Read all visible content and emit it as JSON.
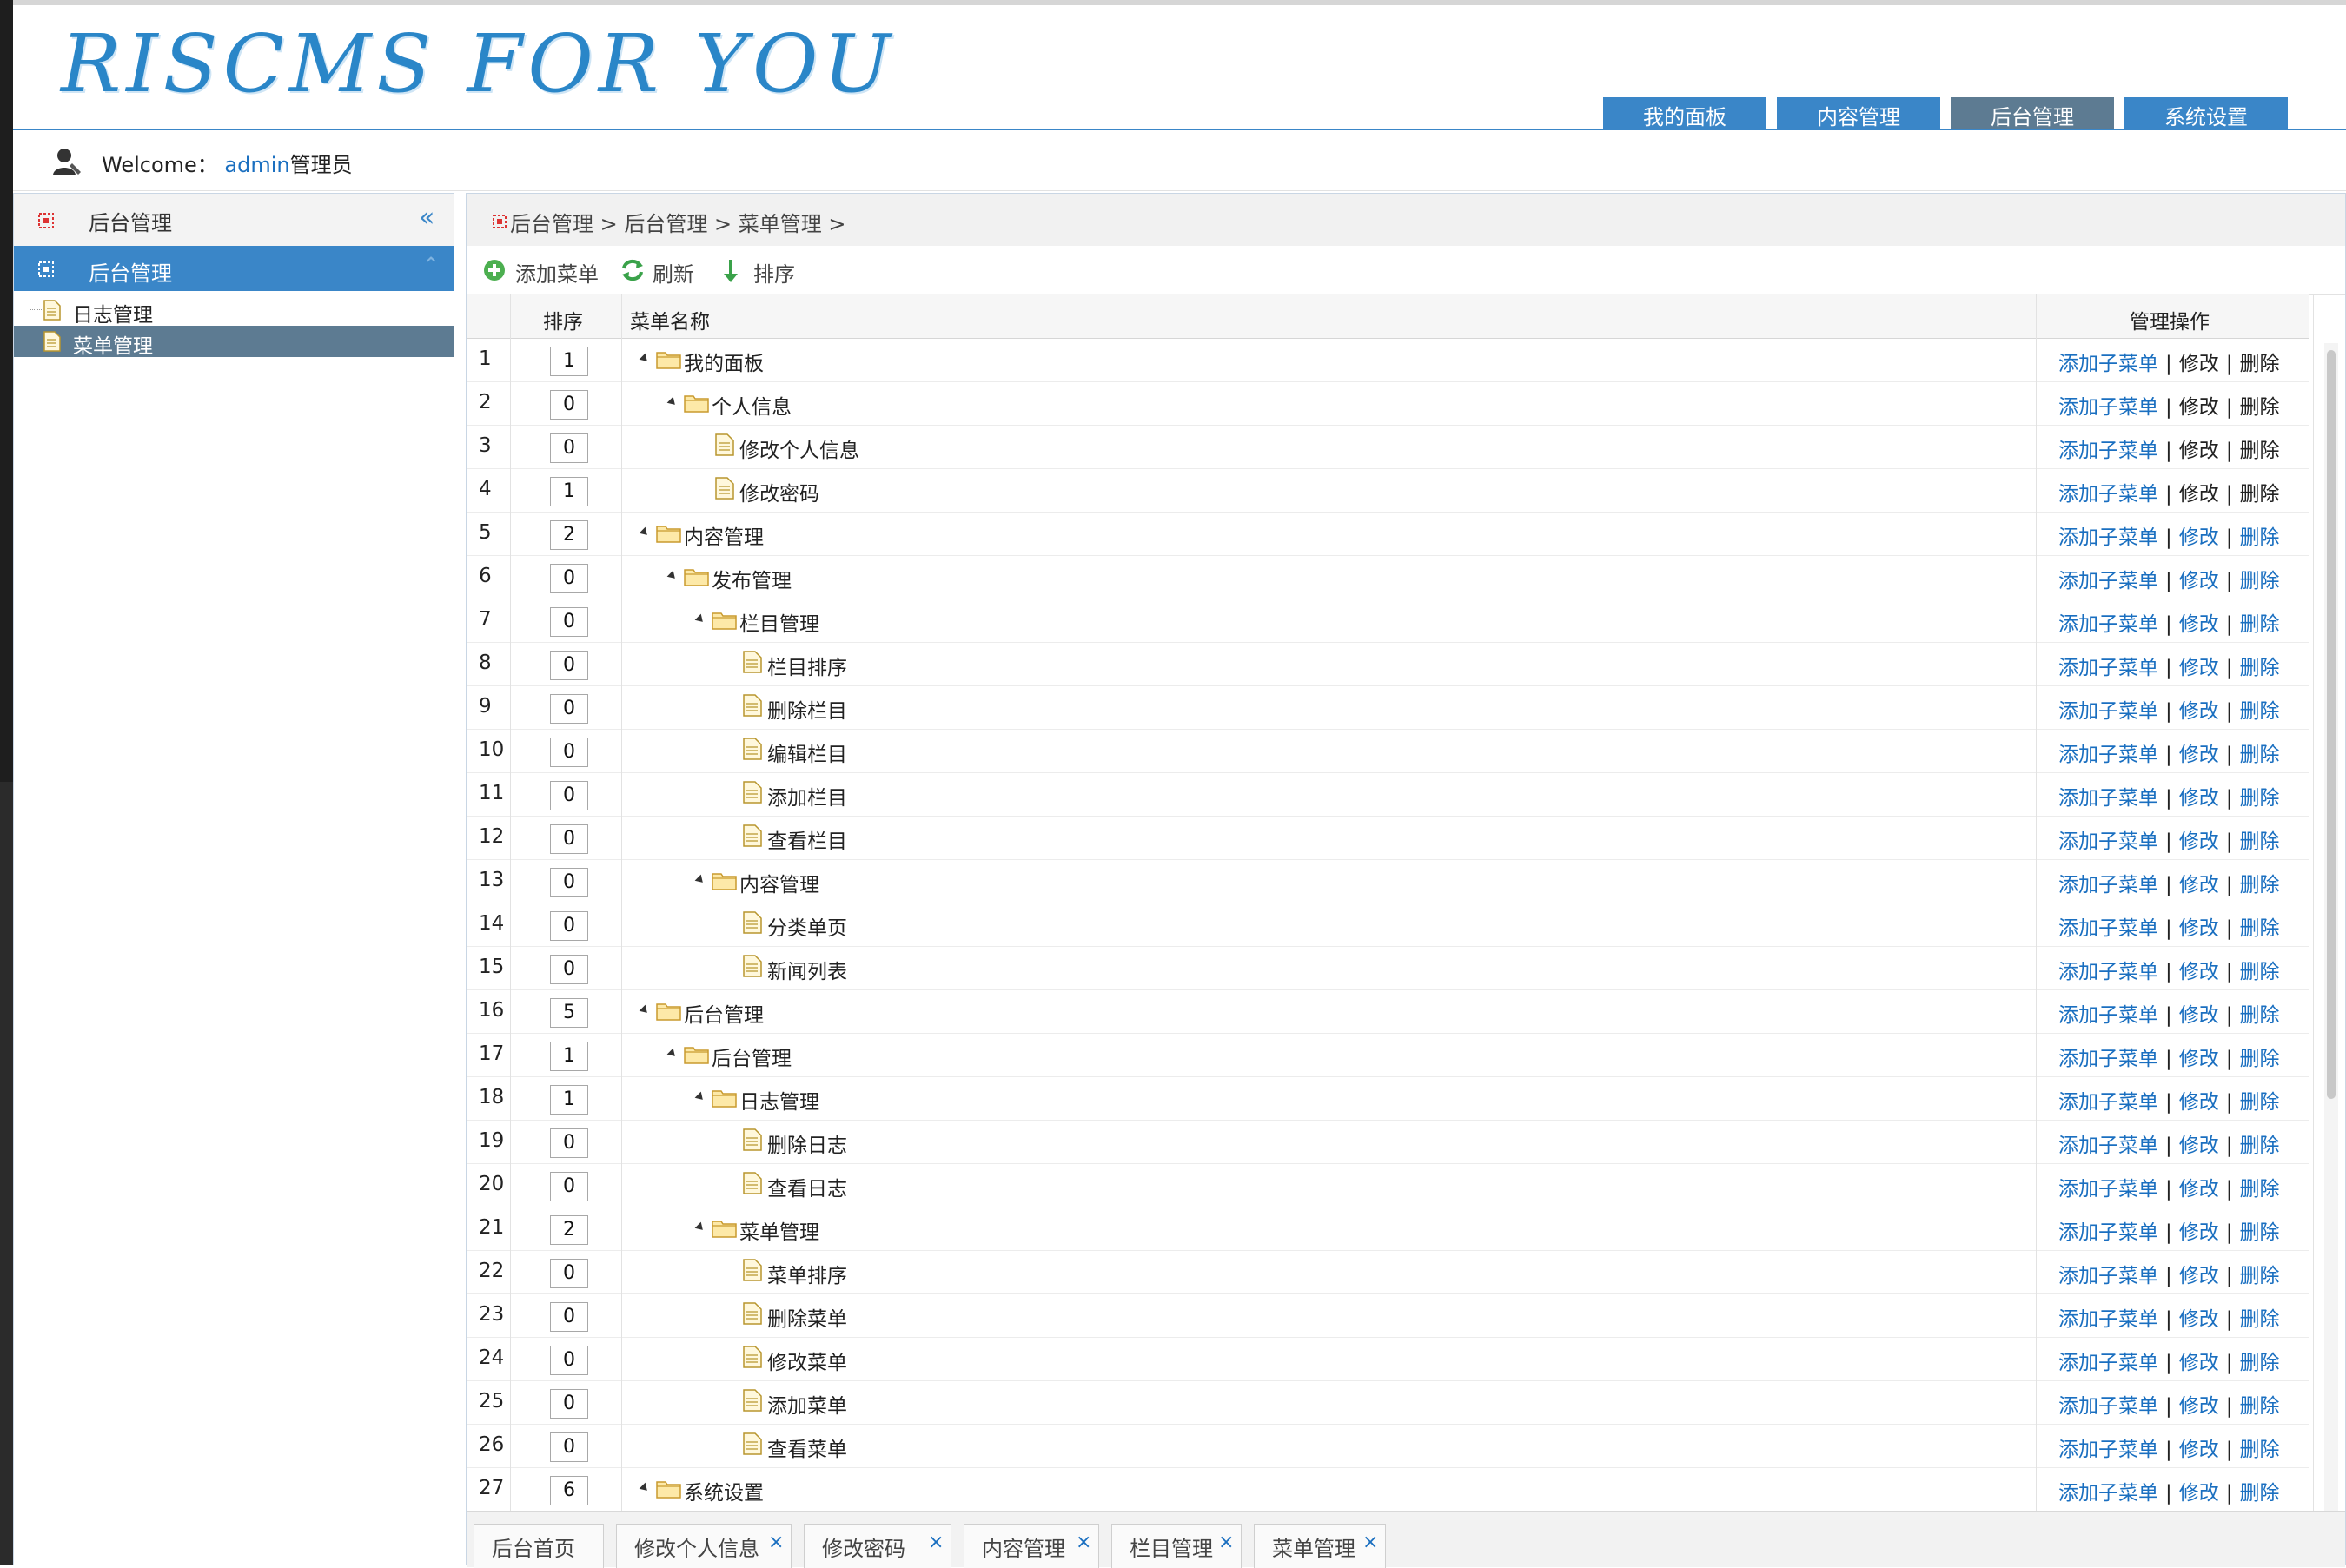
{
  "header": {
    "logo_text": "RISCMS FOR YOU",
    "tabs": [
      {
        "label": "我的面板",
        "active": false
      },
      {
        "label": "内容管理",
        "active": false
      },
      {
        "label": "后台管理",
        "active": true
      },
      {
        "label": "系统设置",
        "active": false
      }
    ]
  },
  "welcome": {
    "prefix": "Welcome：",
    "username": "admin",
    "role": "管理员"
  },
  "sidebar": {
    "section_title": "后台管理",
    "selected_group": "后台管理",
    "items": [
      {
        "label": "日志管理",
        "active": false
      },
      {
        "label": "菜单管理",
        "active": true
      }
    ]
  },
  "breadcrumb": "后台管理 > 后台管理 > 菜单管理 >",
  "toolbar": {
    "add_label": "添加菜单",
    "refresh_label": "刷新",
    "sort_label": "排序"
  },
  "table": {
    "headers": {
      "sort": "排序",
      "name": "菜单名称",
      "ops": "管理操作"
    },
    "op_labels": {
      "add_child": "添加子菜单",
      "edit": "修改",
      "delete": "删除"
    },
    "rows": [
      {
        "n": "1",
        "sort": "1",
        "name": "我的面板",
        "level": 0,
        "folder": true
      },
      {
        "n": "2",
        "sort": "0",
        "name": "个人信息",
        "level": 1,
        "folder": true
      },
      {
        "n": "3",
        "sort": "0",
        "name": "修改个人信息",
        "level": 2,
        "folder": false
      },
      {
        "n": "4",
        "sort": "1",
        "name": "修改密码",
        "level": 2,
        "folder": false
      },
      {
        "n": "5",
        "sort": "2",
        "name": "内容管理",
        "level": 0,
        "folder": true
      },
      {
        "n": "6",
        "sort": "0",
        "name": "发布管理",
        "level": 1,
        "folder": true
      },
      {
        "n": "7",
        "sort": "0",
        "name": "栏目管理",
        "level": 2,
        "folder": true
      },
      {
        "n": "8",
        "sort": "0",
        "name": "栏目排序",
        "level": 3,
        "folder": false
      },
      {
        "n": "9",
        "sort": "0",
        "name": "删除栏目",
        "level": 3,
        "folder": false
      },
      {
        "n": "10",
        "sort": "0",
        "name": "编辑栏目",
        "level": 3,
        "folder": false
      },
      {
        "n": "11",
        "sort": "0",
        "name": "添加栏目",
        "level": 3,
        "folder": false
      },
      {
        "n": "12",
        "sort": "0",
        "name": "查看栏目",
        "level": 3,
        "folder": false
      },
      {
        "n": "13",
        "sort": "0",
        "name": "内容管理",
        "level": 2,
        "folder": true
      },
      {
        "n": "14",
        "sort": "0",
        "name": "分类单页",
        "level": 3,
        "folder": false
      },
      {
        "n": "15",
        "sort": "0",
        "name": "新闻列表",
        "level": 3,
        "folder": false
      },
      {
        "n": "16",
        "sort": "5",
        "name": "后台管理",
        "level": 0,
        "folder": true
      },
      {
        "n": "17",
        "sort": "1",
        "name": "后台管理",
        "level": 1,
        "folder": true
      },
      {
        "n": "18",
        "sort": "1",
        "name": "日志管理",
        "level": 2,
        "folder": true
      },
      {
        "n": "19",
        "sort": "0",
        "name": "删除日志",
        "level": 3,
        "folder": false
      },
      {
        "n": "20",
        "sort": "0",
        "name": "查看日志",
        "level": 3,
        "folder": false
      },
      {
        "n": "21",
        "sort": "2",
        "name": "菜单管理",
        "level": 2,
        "folder": true
      },
      {
        "n": "22",
        "sort": "0",
        "name": "菜单排序",
        "level": 3,
        "folder": false
      },
      {
        "n": "23",
        "sort": "0",
        "name": "删除菜单",
        "level": 3,
        "folder": false
      },
      {
        "n": "24",
        "sort": "0",
        "name": "修改菜单",
        "level": 3,
        "folder": false
      },
      {
        "n": "25",
        "sort": "0",
        "name": "添加菜单",
        "level": 3,
        "folder": false
      },
      {
        "n": "26",
        "sort": "0",
        "name": "查看菜单",
        "level": 3,
        "folder": false
      },
      {
        "n": "27",
        "sort": "6",
        "name": "系统设置",
        "level": 0,
        "folder": true
      }
    ]
  },
  "bottom_tabs": [
    {
      "label": "后台首页",
      "closable": false
    },
    {
      "label": "修改个人信息",
      "closable": true
    },
    {
      "label": "修改密码",
      "closable": true
    },
    {
      "label": "内容管理",
      "closable": true
    },
    {
      "label": "栏目管理",
      "closable": true
    },
    {
      "label": "菜单管理",
      "closable": true
    }
  ],
  "colors": {
    "accent": "#3a86c8",
    "active_tab": "#5d7b92",
    "link": "#1a6fc0"
  }
}
